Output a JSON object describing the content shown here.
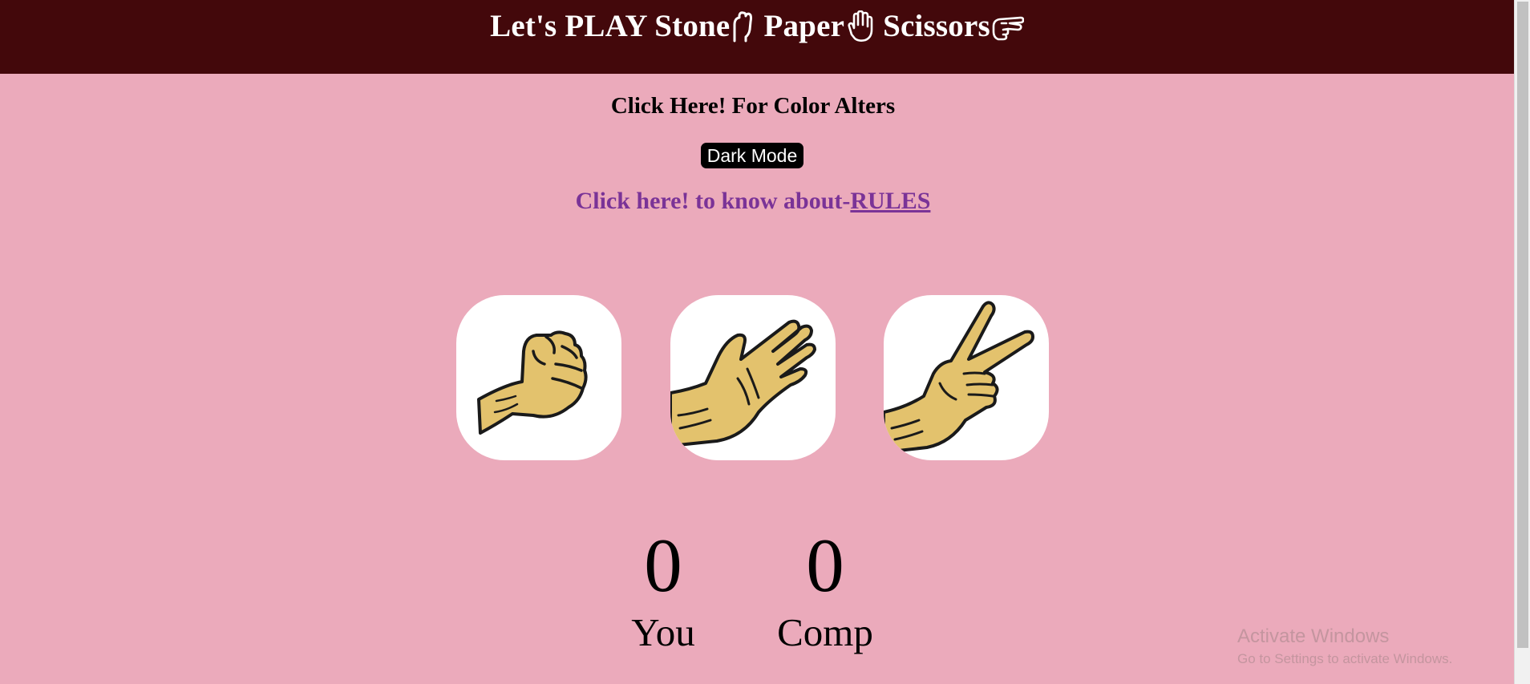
{
  "header": {
    "title_part1": "Let's PLAY Stone",
    "title_part2": "Paper",
    "title_part3": "Scissors",
    "icons": [
      "raised-fist-icon",
      "raised-hand-icon",
      "victory-hand-icon"
    ],
    "background": "#43080b",
    "text_color": "#ffffff"
  },
  "theme": {
    "page_background": "#ebaabb",
    "link_color": "#7a3397"
  },
  "color_section": {
    "heading": "Click Here! For Color Alters",
    "button_label": "Dark Mode"
  },
  "rules": {
    "prefix": "Click here! to know about-",
    "link_label": "RULES"
  },
  "choices": [
    {
      "id": "rock",
      "icon": "rock-fist-icon"
    },
    {
      "id": "paper",
      "icon": "paper-hand-icon"
    },
    {
      "id": "scissors",
      "icon": "scissors-hand-icon"
    }
  ],
  "scoreboard": {
    "user_score": "0",
    "user_label": "You",
    "comp_score": "0",
    "comp_label": "Comp"
  },
  "watermark": {
    "title": "Activate Windows",
    "subtitle": "Go to Settings to activate Windows."
  }
}
